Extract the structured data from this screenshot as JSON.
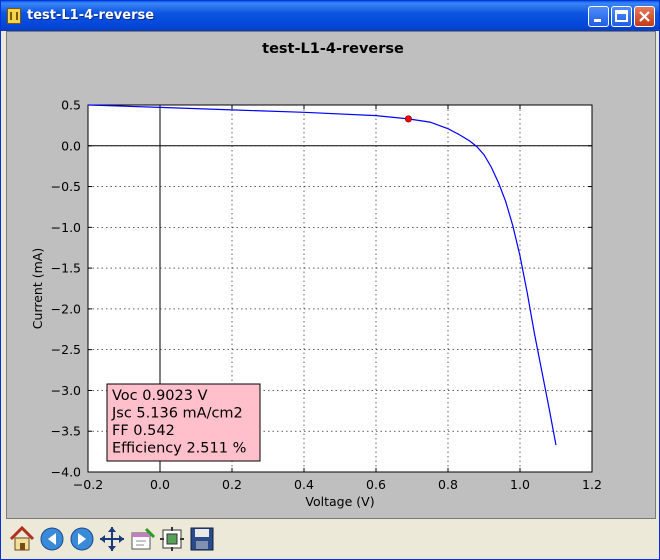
{
  "window": {
    "title": "test-L1-4-reverse"
  },
  "chart_data": {
    "type": "line",
    "title": "test-L1-4-reverse",
    "xlabel": "Voltage (V)",
    "ylabel": "Current (mA)",
    "xlim": [
      -0.2,
      1.2
    ],
    "ylim": [
      -4.0,
      0.5
    ],
    "x_ticks": [
      -0.2,
      0.0,
      0.2,
      0.4,
      0.6,
      0.8,
      1.0,
      1.2
    ],
    "x_tick_labels": [
      "−0.2",
      "0.0",
      "0.2",
      "0.4",
      "0.6",
      "0.8",
      "1.0",
      "1.2"
    ],
    "y_ticks": [
      0.5,
      0.0,
      -0.5,
      -1.0,
      -1.5,
      -2.0,
      -2.5,
      -3.0,
      -3.5,
      -4.0
    ],
    "y_tick_labels": [
      "0.5",
      "0.0",
      "−0.5",
      "−1.0",
      "−1.5",
      "−2.0",
      "−2.5",
      "−3.0",
      "−3.5",
      "−4.0"
    ],
    "grid": true,
    "series": [
      {
        "color": "#0000ff",
        "x": [
          -0.2,
          0.0,
          0.2,
          0.4,
          0.6,
          0.69,
          0.75,
          0.8,
          0.83,
          0.86,
          0.88,
          0.9,
          0.92,
          0.94,
          0.96,
          0.98,
          1.0,
          1.02,
          1.04,
          1.06,
          1.08,
          1.1
        ],
        "y": [
          0.5,
          0.47,
          0.44,
          0.41,
          0.37,
          0.33,
          0.29,
          0.21,
          0.14,
          0.06,
          -0.01,
          -0.11,
          -0.26,
          -0.45,
          -0.68,
          -0.98,
          -1.35,
          -1.8,
          -2.3,
          -2.75,
          -3.2,
          -3.67
        ]
      }
    ],
    "marker": {
      "x": 0.69,
      "y": 0.33,
      "color": "#ff0000"
    },
    "annotation": {
      "lines": [
        "Voc 0.9023 V",
        "Jsc 5.136 mA/cm2",
        "FF 0.542",
        "Efficiency 2.511 %"
      ],
      "background": "#ffc0cb"
    }
  },
  "toolbar": {
    "icons": [
      "home-icon",
      "back-icon",
      "forward-icon",
      "pan-icon",
      "zoom-icon",
      "subplots-icon",
      "save-icon"
    ]
  }
}
